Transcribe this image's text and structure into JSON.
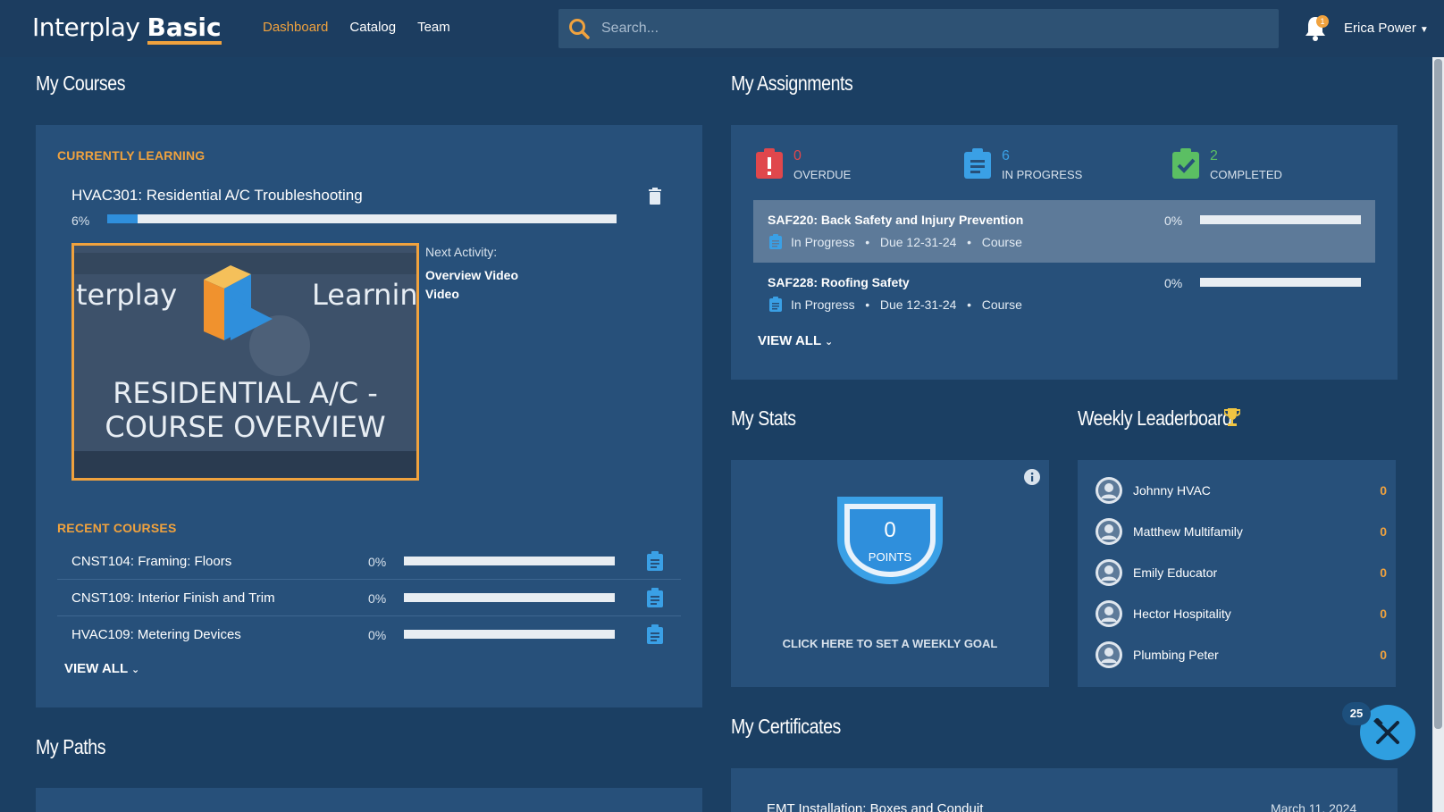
{
  "header": {
    "logo_part1": "Interplay",
    "logo_part2": "Basic",
    "nav": [
      {
        "label": "Dashboard",
        "active": true
      },
      {
        "label": "Catalog",
        "active": false
      },
      {
        "label": "Team",
        "active": false
      }
    ],
    "search_placeholder": "Search...",
    "notification_count": "1",
    "user_name": "Erica Power"
  },
  "my_courses": {
    "title": "My Courses",
    "currently_learning_label": "CURRENTLY LEARNING",
    "current_course": {
      "name": "HVAC301: Residential A/C Troubleshooting",
      "percent_label": "6%",
      "progress": 0.06,
      "thumbnail_text_left": "terplay",
      "thumbnail_text_right": "Learnin",
      "thumbnail_title_line1": "RESIDENTIAL A/C -",
      "thumbnail_title_line2": "COURSE OVERVIEW",
      "next_activity_label": "Next Activity:",
      "next_activity_name": "Overview Video",
      "next_activity_type": "Video"
    },
    "recent_label": "RECENT COURSES",
    "recent": [
      {
        "name": "CNST104: Framing: Floors",
        "percent": "0%"
      },
      {
        "name": "CNST109: Interior Finish and Trim",
        "percent": "0%"
      },
      {
        "name": "HVAC109: Metering Devices",
        "percent": "0%"
      }
    ],
    "view_all": "VIEW ALL"
  },
  "my_paths": {
    "title": "My Paths"
  },
  "my_assignments": {
    "title": "My Assignments",
    "stats": [
      {
        "count": "0",
        "label": "OVERDUE",
        "color": "#e0474c"
      },
      {
        "count": "6",
        "label": "IN PROGRESS",
        "color": "#3aa0e6"
      },
      {
        "count": "2",
        "label": "COMPLETED",
        "color": "#5bbf63"
      }
    ],
    "items": [
      {
        "name": "SAF220: Back Safety and Injury Prevention",
        "status": "In Progress",
        "due": "Due 12-31-24",
        "type": "Course",
        "percent": "0%"
      },
      {
        "name": "SAF228: Roofing Safety",
        "status": "In Progress",
        "due": "Due 12-31-24",
        "type": "Course",
        "percent": "0%"
      }
    ],
    "view_all": "VIEW ALL"
  },
  "my_stats": {
    "title": "My Stats",
    "points_value": "0",
    "points_label": "POINTS",
    "goal_cta": "CLICK HERE TO SET A WEEKLY GOAL"
  },
  "leaderboard": {
    "title": "Weekly Leaderboard",
    "entries": [
      {
        "name": "Johnny HVAC",
        "score": "0"
      },
      {
        "name": "Matthew Multifamily",
        "score": "0"
      },
      {
        "name": "Emily Educator",
        "score": "0"
      },
      {
        "name": "Hector Hospitality",
        "score": "0"
      },
      {
        "name": "Plumbing Peter",
        "score": "0"
      }
    ]
  },
  "my_certificates": {
    "title": "My Certificates",
    "items": [
      {
        "name": "EMT Installation: Boxes and Conduit",
        "date": "March 11, 2024"
      }
    ]
  },
  "help_widget": {
    "badge": "25"
  },
  "colors": {
    "accent": "#f0a23e",
    "background": "#1b3f63",
    "panel": "#27507a",
    "progress": "#2f8fdc"
  }
}
